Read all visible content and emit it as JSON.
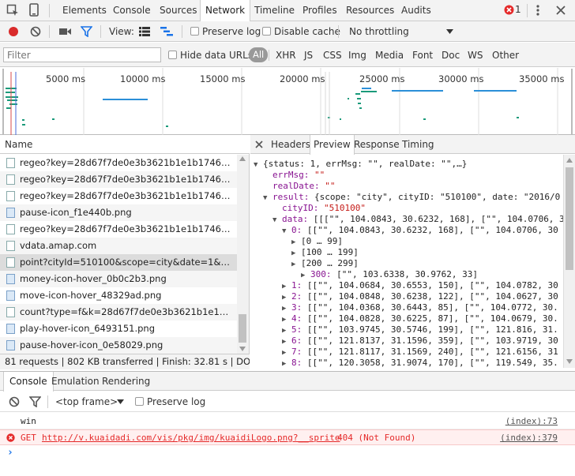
{
  "devtools": {
    "main_tabs": [
      "Elements",
      "Console",
      "Sources",
      "Network",
      "Timeline",
      "Profiles",
      "Resources",
      "Audits"
    ],
    "selected_tab": "Network",
    "error_count": "1"
  },
  "toolbar": {
    "view_label": "View:",
    "preserve_log": "Preserve log",
    "disable_cache": "Disable cache",
    "throttling": "No throttling"
  },
  "filterbar": {
    "filter_placeholder": "Filter",
    "hide_data_urls": "Hide data URLs",
    "types": [
      "All",
      "XHR",
      "JS",
      "CSS",
      "Img",
      "Media",
      "Font",
      "Doc",
      "WS",
      "Other"
    ]
  },
  "overview": {
    "ticks": [
      "5000 ms",
      "10000 ms",
      "15000 ms",
      "20000 ms",
      "25000 ms",
      "30000 ms",
      "35000 ms"
    ]
  },
  "requests": {
    "header": "Name",
    "rows": [
      {
        "name": "regeo?key=28d67f7de0e3b3621b1e1b1746bbd6...",
        "kind": "doc"
      },
      {
        "name": "regeo?key=28d67f7de0e3b3621b1e1b1746bbd6...",
        "kind": "doc"
      },
      {
        "name": "regeo?key=28d67f7de0e3b3621b1e1b1746bbd6...",
        "kind": "doc"
      },
      {
        "name": "pause-icon_f1e440b.png",
        "kind": "img"
      },
      {
        "name": "regeo?key=28d67f7de0e3b3621b1e1b1746bbd6...",
        "kind": "doc"
      },
      {
        "name": "vdata.amap.com",
        "kind": "doc"
      },
      {
        "name": "point?cityId=510100&scope=city&date=1&dime...",
        "kind": "doc"
      },
      {
        "name": "money-icon-hover_0b0c2b3.png",
        "kind": "img"
      },
      {
        "name": "move-icon-hover_48329ad.png",
        "kind": "img"
      },
      {
        "name": "count?type=f&k=28d67f7de0e3b3621b1e1b1746...",
        "kind": "doc"
      },
      {
        "name": "play-hover-icon_6493151.png",
        "kind": "img"
      },
      {
        "name": "pause-hover-icon_0e58029.png",
        "kind": "img"
      }
    ],
    "status": "81 requests  |  802 KB transferred  |  Finish: 32.81 s  |  DO..."
  },
  "preview_tabs": [
    "Headers",
    "Preview",
    "Response",
    "Timing"
  ],
  "preview": {
    "lines": [
      {
        "indent": 0,
        "tri": "▼",
        "text": "{status: 1, errMsg: \"\", realDate: \"\",…}",
        "cls": ""
      },
      {
        "indent": 2,
        "tri": "",
        "key": "errMsg: ",
        "val": "\"\"",
        "vcls": "s"
      },
      {
        "indent": 2,
        "tri": "",
        "key": "realDate: ",
        "val": "\"\"",
        "vcls": "s"
      },
      {
        "indent": 1,
        "tri": "▼",
        "key": "result: ",
        "val": "{scope: \"city\", cityID: \"510100\", date: \"2016/0",
        "vcls": ""
      },
      {
        "indent": 3,
        "tri": "",
        "key": "cityID: ",
        "val": "\"510100\"",
        "vcls": "s"
      },
      {
        "indent": 2,
        "tri": "▼",
        "key": "data: ",
        "val": "[[[\"\", 104.0843, 30.6232, 168], [\"\", 104.0706, 3",
        "vcls": ""
      },
      {
        "indent": 3,
        "tri": "▼",
        "key": "0: ",
        "val": "[[\"\", 104.0843, 30.6232, 168], [\"\", 104.0706, 30",
        "vcls": ""
      },
      {
        "indent": 4,
        "tri": "▶",
        "key": "",
        "val": "[0 … 99]",
        "vcls": ""
      },
      {
        "indent": 4,
        "tri": "▶",
        "key": "",
        "val": "[100 … 199]",
        "vcls": ""
      },
      {
        "indent": 4,
        "tri": "▶",
        "key": "",
        "val": "[200 … 299]",
        "vcls": ""
      },
      {
        "indent": 5,
        "tri": "▶",
        "key": "300: ",
        "val": "[\"\", 103.6338, 30.9762, 33]",
        "vcls": ""
      },
      {
        "indent": 3,
        "tri": "▶",
        "key": "1: ",
        "val": "[[\"\", 104.0684, 30.6553, 150], [\"\", 104.0782, 30",
        "vcls": ""
      },
      {
        "indent": 3,
        "tri": "▶",
        "key": "2: ",
        "val": "[[\"\", 104.0848, 30.6238, 122], [\"\", 104.0627, 30",
        "vcls": ""
      },
      {
        "indent": 3,
        "tri": "▶",
        "key": "3: ",
        "val": "[[\"\", 104.0368, 30.6443, 85], [\"\", 104.0772, 30.",
        "vcls": ""
      },
      {
        "indent": 3,
        "tri": "▶",
        "key": "4: ",
        "val": "[[\"\", 104.0828, 30.6225, 87], [\"\", 104.0679, 30.",
        "vcls": ""
      },
      {
        "indent": 3,
        "tri": "▶",
        "key": "5: ",
        "val": "[[\"\", 103.9745, 30.5746, 199], [\"\", 121.816, 31.",
        "vcls": ""
      },
      {
        "indent": 3,
        "tri": "▶",
        "key": "6: ",
        "val": "[[\"\", 121.8137, 31.1596, 359], [\"\", 103.9719, 30",
        "vcls": ""
      },
      {
        "indent": 3,
        "tri": "▶",
        "key": "7: ",
        "val": "[[\"\", 121.8117, 31.1569, 240], [\"\", 121.6156, 31",
        "vcls": ""
      },
      {
        "indent": 3,
        "tri": "▶",
        "key": "8: ",
        "val": "[[\"\", 120.3058, 31.9074, 170], [\"\", 119.549, 35.",
        "vcls": ""
      }
    ]
  },
  "drawer": {
    "tabs": [
      "Console",
      "Emulation",
      "Rendering"
    ],
    "frame": "<top frame>",
    "preserve_log": "Preserve log",
    "log": [
      {
        "text": "win",
        "src": "(index):73",
        "level": "log"
      },
      {
        "method": "GET ",
        "url": "http://v.kuaidadi.com/vis/pkg/img/kuaidiLogo.png?__sprite",
        "status": " 404 (Not Found)",
        "src": "(index):379",
        "level": "error"
      }
    ],
    "prompt": "›"
  },
  "colors": {
    "accent": "#1a73e8",
    "record": "#d92b2b",
    "error_bg": "#fff0f0",
    "error_text": "#e52a2a"
  }
}
